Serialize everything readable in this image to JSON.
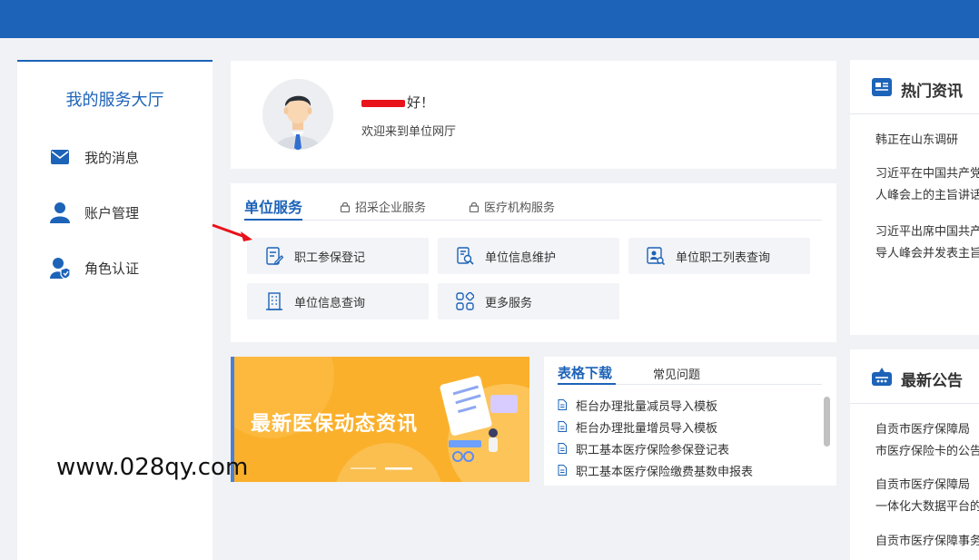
{
  "sidebar": {
    "title": "我的服务大厅",
    "items": [
      {
        "label": "我的消息",
        "icon": "mail-icon"
      },
      {
        "label": "账户管理",
        "icon": "user-icon"
      },
      {
        "label": "角色认证",
        "icon": "user-badge-icon"
      }
    ]
  },
  "welcome": {
    "greeting_suffix": "好！",
    "subtitle": "欢迎来到单位网厅"
  },
  "services": {
    "tabs": [
      {
        "label": "单位服务",
        "active": true
      },
      {
        "label": "招采企业服务",
        "locked": true
      },
      {
        "label": "医疗机构服务",
        "locked": true
      }
    ],
    "items": [
      {
        "label": "职工参保登记",
        "icon": "edit-doc-icon"
      },
      {
        "label": "单位信息维护",
        "icon": "doc-search-icon"
      },
      {
        "label": "单位职工列表查询",
        "icon": "person-search-icon"
      },
      {
        "label": "单位信息查询",
        "icon": "building-icon"
      },
      {
        "label": "更多服务",
        "icon": "more-grid-icon"
      }
    ]
  },
  "banner": {
    "text": "最新医保动态资讯"
  },
  "downloads": {
    "tabs": [
      {
        "label": "表格下载",
        "active": true
      },
      {
        "label": "常见问题"
      }
    ],
    "items": [
      "柜台办理批量减员导入模板",
      "柜台办理批量增员导入模板",
      "职工基本医疗保险参保登记表",
      "职工基本医疗保险缴费基数申报表"
    ]
  },
  "hot_news": {
    "title": "热门资讯",
    "items": [
      "韩正在山东调研",
      "习近平在中国共产党",
      "人峰会上的主旨讲话",
      "习近平出席中国共产",
      "导人峰会并发表主旨"
    ]
  },
  "announcements": {
    "title": "最新公告",
    "items": [
      "自贡市医疗保障局",
      "市医疗保险卡的公告",
      "自贡市医疗保障局",
      "一体化大数据平台的",
      "自贡市医疗保障事务"
    ]
  },
  "watermark": "www.028qy.com",
  "colors": {
    "brand": "#1d63b8",
    "banner": "#fbb02b",
    "redaction": "#e8131b"
  }
}
